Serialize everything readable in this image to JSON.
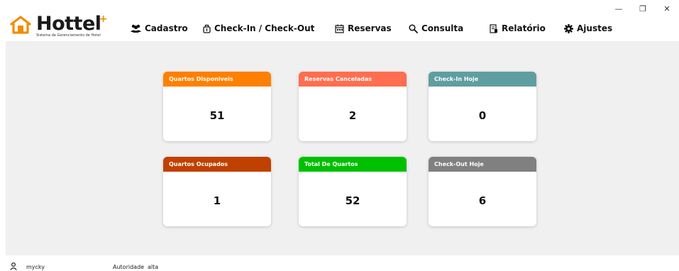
{
  "window": {
    "minimize": "—",
    "restore": "❐",
    "close": "✕"
  },
  "brand": {
    "title": "Hottel",
    "plus": "+",
    "subtitle": "Sistema de Gerenciamento de Hotel",
    "accent": "#f28c00"
  },
  "nav": [
    {
      "label": "Cadastro",
      "icon": "users-icon"
    },
    {
      "label": "Check-In / Check-Out",
      "icon": "luggage-icon"
    },
    {
      "label": "Reservas",
      "icon": "calendar-icon"
    },
    {
      "label": "Consulta",
      "icon": "search-icon"
    },
    {
      "label": "Relatório",
      "icon": "report-icon"
    },
    {
      "label": "Ajustes",
      "icon": "gear-icon"
    }
  ],
  "cards": [
    {
      "title": "Quartos Disponiveis",
      "value": "51",
      "color": "#ff8000"
    },
    {
      "title": "Reservas Canceladas",
      "value": "2",
      "color": "#ff6e50"
    },
    {
      "title": "Check-In Hoje",
      "value": "0",
      "color": "#5f9ea0"
    },
    {
      "title": "Quartos Ocupados",
      "value": "1",
      "color": "#c04000"
    },
    {
      "title": "Total De Quartos",
      "value": "52",
      "color": "#00c000"
    },
    {
      "title": "Check-Out Hoje",
      "value": "6",
      "color": "#808080"
    }
  ],
  "footer": {
    "icon": "user-icon",
    "username": "mycky",
    "authority_label": "Autoridade",
    "authority_value": "alta"
  }
}
